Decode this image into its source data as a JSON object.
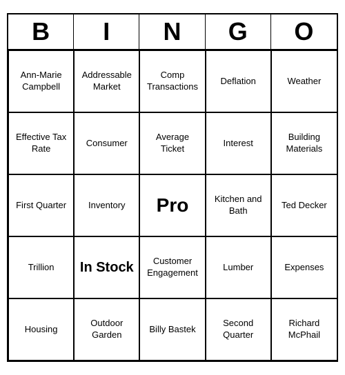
{
  "header": {
    "letters": [
      "B",
      "I",
      "N",
      "G",
      "O"
    ]
  },
  "cells": [
    {
      "text": "Ann-Marie Campbell",
      "size": "normal"
    },
    {
      "text": "Addressable Market",
      "size": "normal"
    },
    {
      "text": "Comp Transactions",
      "size": "normal"
    },
    {
      "text": "Deflation",
      "size": "normal"
    },
    {
      "text": "Weather",
      "size": "normal"
    },
    {
      "text": "Effective Tax Rate",
      "size": "normal"
    },
    {
      "text": "Consumer",
      "size": "normal"
    },
    {
      "text": "Average Ticket",
      "size": "normal"
    },
    {
      "text": "Interest",
      "size": "normal"
    },
    {
      "text": "Building Materials",
      "size": "normal"
    },
    {
      "text": "First Quarter",
      "size": "normal"
    },
    {
      "text": "Inventory",
      "size": "normal"
    },
    {
      "text": "Pro",
      "size": "large"
    },
    {
      "text": "Kitchen and Bath",
      "size": "normal"
    },
    {
      "text": "Ted Decker",
      "size": "normal"
    },
    {
      "text": "Trillion",
      "size": "normal"
    },
    {
      "text": "In Stock",
      "size": "medium-large"
    },
    {
      "text": "Customer Engagement",
      "size": "normal"
    },
    {
      "text": "Lumber",
      "size": "normal"
    },
    {
      "text": "Expenses",
      "size": "normal"
    },
    {
      "text": "Housing",
      "size": "normal"
    },
    {
      "text": "Outdoor Garden",
      "size": "normal"
    },
    {
      "text": "Billy Bastek",
      "size": "normal"
    },
    {
      "text": "Second Quarter",
      "size": "normal"
    },
    {
      "text": "Richard McPhail",
      "size": "normal"
    }
  ]
}
